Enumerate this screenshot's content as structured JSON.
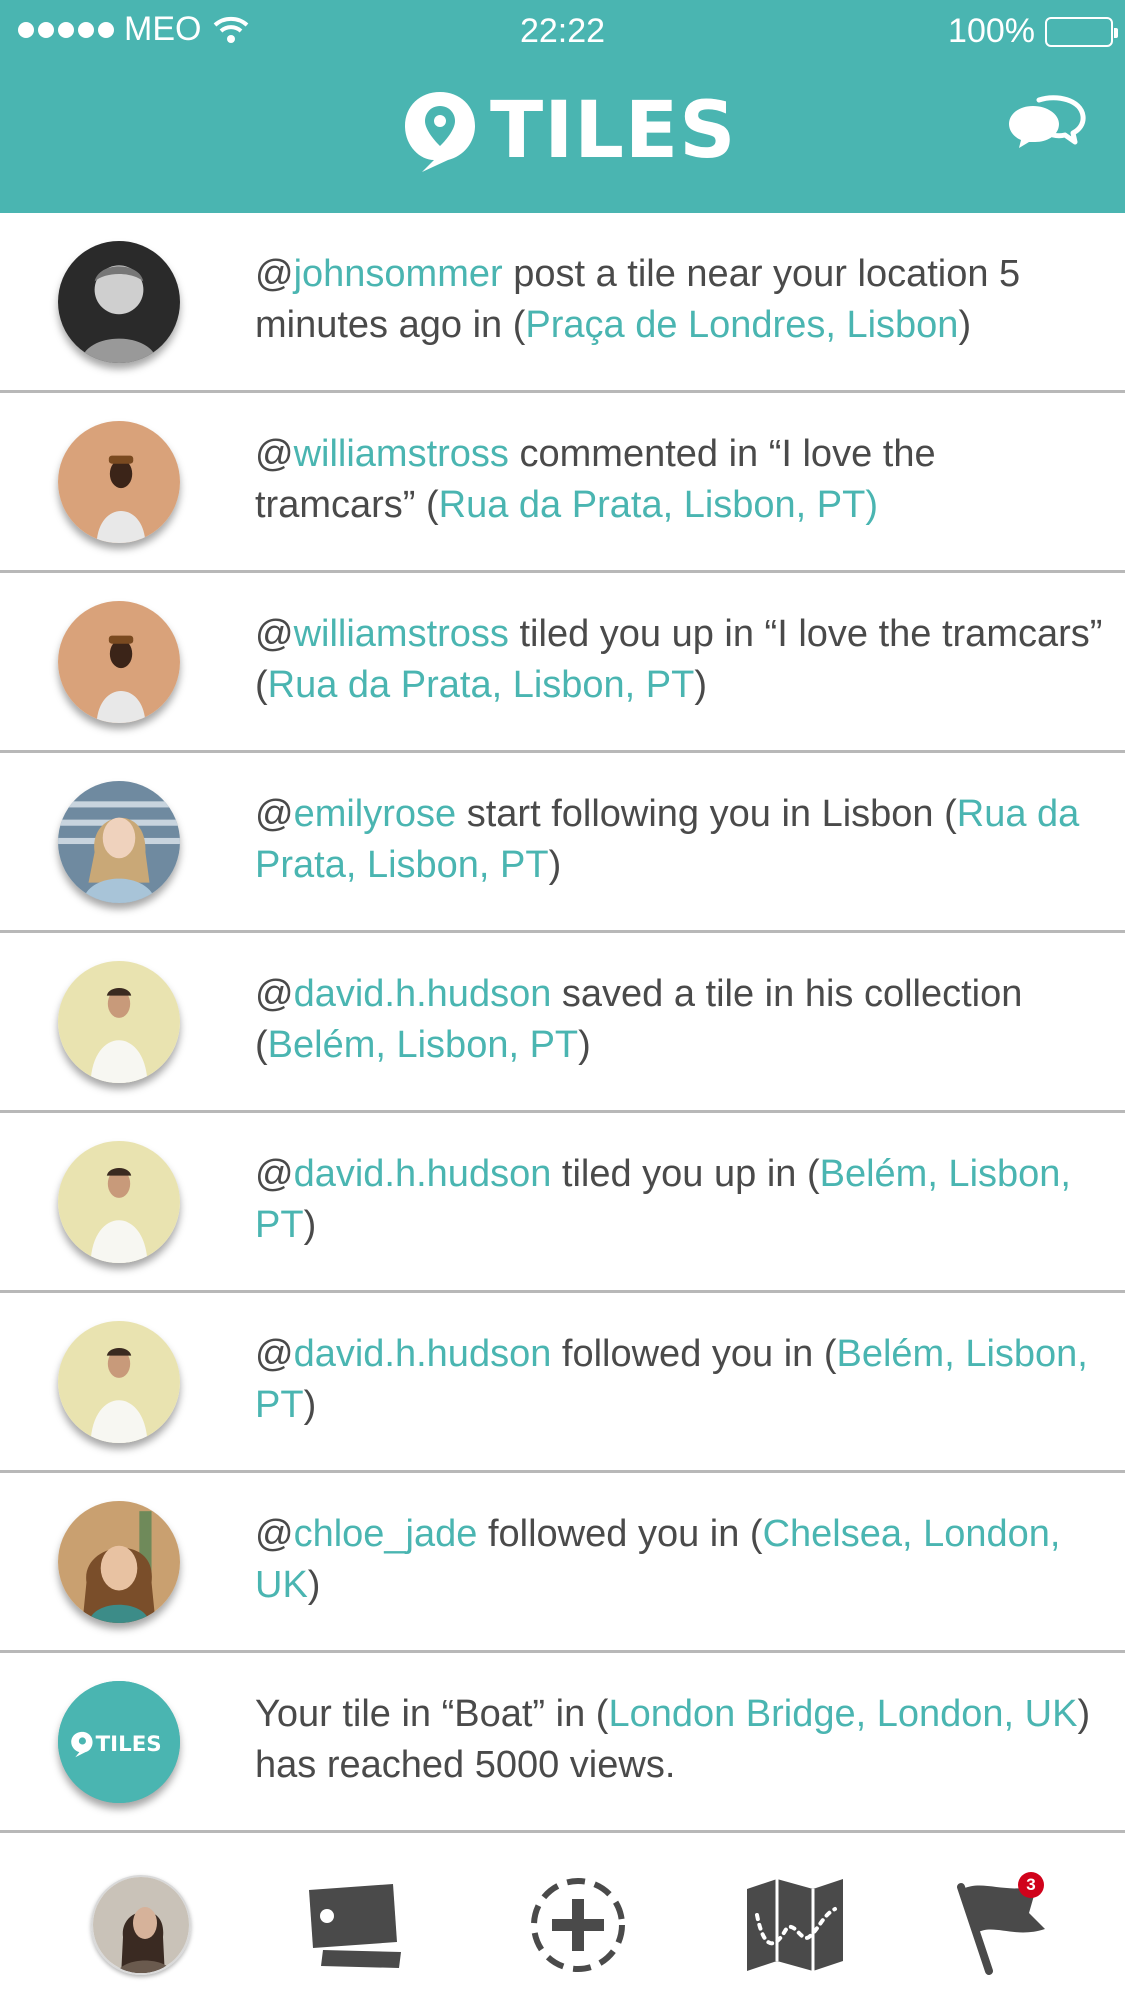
{
  "status_bar": {
    "carrier": "MEO",
    "time": "22:22",
    "battery": "100%"
  },
  "header": {
    "app_name": "TILES"
  },
  "notifications": [
    {
      "user": "johnsommer",
      "parts": [
        [
          "@",
          ""
        ],
        [
          "johnsommer",
          "teal"
        ],
        [
          " post a tile near your location 5 minutes ago in  (",
          ""
        ],
        [
          "Praça de Londres, Lisbon",
          "teal"
        ],
        [
          ")",
          ""
        ]
      ]
    },
    {
      "user": "williamstross",
      "parts": [
        [
          "@",
          ""
        ],
        [
          "williamstross",
          "teal"
        ],
        [
          " commented in “I love the tramcars” (",
          ""
        ],
        [
          "Rua da Prata, Lisbon, PT)",
          "teal"
        ]
      ]
    },
    {
      "user": "williamstross",
      "parts": [
        [
          "@",
          ""
        ],
        [
          "williamstross",
          "teal"
        ],
        [
          " tiled you up in “I love the tramcars” (",
          ""
        ],
        [
          "Rua da Prata, Lisbon, PT",
          "teal"
        ],
        [
          ")",
          ""
        ]
      ]
    },
    {
      "user": "emilyrose",
      "parts": [
        [
          "@",
          ""
        ],
        [
          "emilyrose",
          "teal"
        ],
        [
          " start following you in Lisbon (",
          ""
        ],
        [
          "Rua da Prata, Lisbon, PT",
          "teal"
        ],
        [
          ")",
          ""
        ]
      ]
    },
    {
      "user": "david.h.hudson",
      "parts": [
        [
          "@",
          ""
        ],
        [
          "david.h.hudson",
          "teal"
        ],
        [
          " saved a tile in his collection  (",
          ""
        ],
        [
          "Belém, Lisbon, PT",
          "teal"
        ],
        [
          ")",
          ""
        ]
      ]
    },
    {
      "user": "david.h.hudson",
      "parts": [
        [
          "@",
          ""
        ],
        [
          "david.h.hudson",
          "teal"
        ],
        [
          " tiled you up in (",
          ""
        ],
        [
          "Belém, Lisbon, PT",
          "teal"
        ],
        [
          ")",
          ""
        ]
      ]
    },
    {
      "user": "david.h.hudson",
      "parts": [
        [
          "@",
          ""
        ],
        [
          "david.h.hudson",
          "teal"
        ],
        [
          " followed you in (",
          ""
        ],
        [
          "Belém, Lisbon, PT",
          "teal"
        ],
        [
          ")",
          ""
        ]
      ]
    },
    {
      "user": "chloe_jade",
      "parts": [
        [
          "@",
          ""
        ],
        [
          "chloe_jade",
          "teal"
        ],
        [
          " followed you in (",
          ""
        ],
        [
          "Chelsea, London, UK",
          "teal"
        ],
        [
          ")",
          ""
        ]
      ]
    },
    {
      "user": "TILES",
      "parts": [
        [
          "Your tile in “Boat” in (",
          ""
        ],
        [
          "London Bridge, London, UK",
          "teal"
        ],
        [
          ") has reached 5000 views.",
          ""
        ]
      ]
    }
  ],
  "tabbar": {
    "flag_badge": "3"
  },
  "colors": {
    "accent": "#4ab5b1",
    "text": "#4a4a4a",
    "badge": "#d0021b",
    "icon": "#4a4a4a"
  }
}
